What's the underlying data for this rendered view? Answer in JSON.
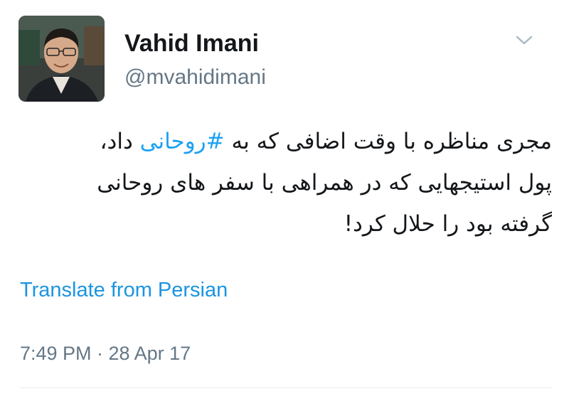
{
  "user": {
    "display_name": "Vahid Imani",
    "handle": "@mvahidimani"
  },
  "header": {
    "menu_icon": "chevron-down-icon"
  },
  "tweet": {
    "line1_before": "مجری مناظره با وقت اضافی که به ",
    "hashtag": "#روحانی",
    "line1_after": " داد،",
    "line2": "پول استیجهایی که در همراهی با سفر های روحانی",
    "line3": "گرفته بود را حلال کرد!"
  },
  "translate_label": "Translate from Persian",
  "timestamp": "7:49 PM · 28 Apr 17",
  "colors": {
    "link": "#1b95e0",
    "hashtag": "#1da1f2",
    "secondary_text": "#657786"
  }
}
